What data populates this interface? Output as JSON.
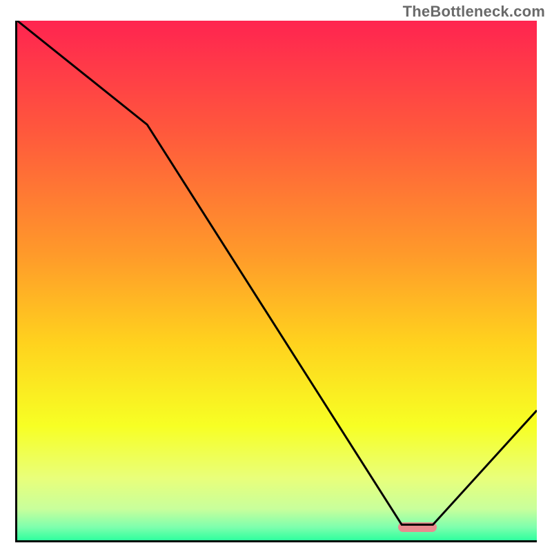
{
  "watermark": "TheBottleneck.com",
  "chart_data": {
    "type": "line",
    "title": "",
    "xlabel": "",
    "ylabel": "",
    "xlim": [
      0,
      100
    ],
    "ylim": [
      0,
      100
    ],
    "x": [
      0,
      25,
      74,
      80,
      100
    ],
    "values": [
      100,
      80,
      3,
      3,
      25
    ],
    "marker": {
      "x": 77,
      "y": 2.5,
      "shape": "pill",
      "color": "#e98b8f"
    },
    "background_gradient": {
      "stops": [
        {
          "pos": 0.0,
          "color": "#ff2450"
        },
        {
          "pos": 0.22,
          "color": "#ff5a3c"
        },
        {
          "pos": 0.45,
          "color": "#ff9a2a"
        },
        {
          "pos": 0.62,
          "color": "#ffd21e"
        },
        {
          "pos": 0.78,
          "color": "#f7ff24"
        },
        {
          "pos": 0.88,
          "color": "#e9ff7a"
        },
        {
          "pos": 0.94,
          "color": "#c8ff9c"
        },
        {
          "pos": 0.975,
          "color": "#7dffad"
        },
        {
          "pos": 1.0,
          "color": "#2fff9e"
        }
      ]
    },
    "line_style": {
      "stroke": "#000000",
      "width": 3
    }
  }
}
